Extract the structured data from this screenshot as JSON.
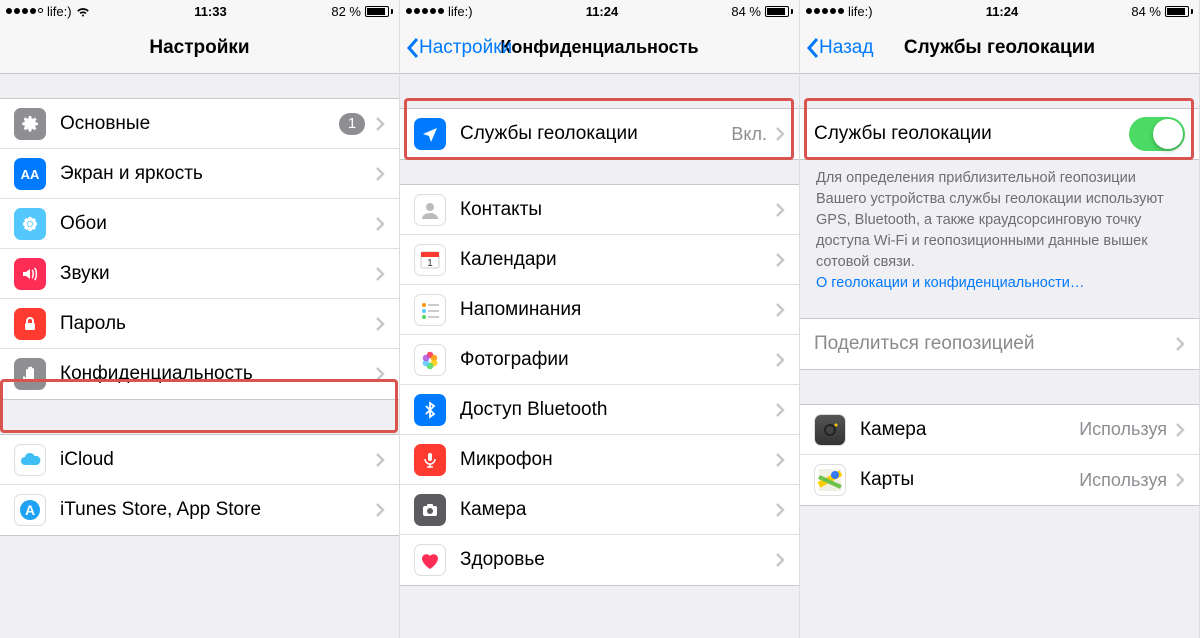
{
  "screen1": {
    "status": {
      "carrier": "life:)",
      "time": "11:33",
      "battery_pct": "82 %"
    },
    "title": "Настройки",
    "group1": [
      {
        "key": "general",
        "label": "Основные",
        "badge": "1",
        "icon": "gear",
        "color": "ic-gray"
      },
      {
        "key": "display",
        "label": "Экран и яркость",
        "icon": "text-size",
        "color": "ic-blue"
      },
      {
        "key": "wallpaper",
        "label": "Обои",
        "icon": "flower",
        "color": "ic-cyan"
      },
      {
        "key": "sounds",
        "label": "Звуки",
        "icon": "speaker",
        "color": "ic-red"
      },
      {
        "key": "passcode",
        "label": "Пароль",
        "icon": "lock",
        "color": "ic-red"
      },
      {
        "key": "privacy",
        "label": "Конфиденциальность",
        "icon": "hand",
        "color": "ic-gray"
      }
    ],
    "group2": [
      {
        "key": "icloud",
        "label": "iCloud",
        "icon": "cloud",
        "color": "ic-white"
      },
      {
        "key": "itunes",
        "label": "iTunes Store, App Store",
        "icon": "appstore",
        "color": "ic-white"
      }
    ]
  },
  "screen2": {
    "status": {
      "carrier": "life:)",
      "time": "11:24",
      "battery_pct": "84 %"
    },
    "back": "Настройки",
    "title": "Конфиденциальность",
    "group1": [
      {
        "key": "location",
        "label": "Службы геолокации",
        "detail": "Вкл.",
        "icon": "location",
        "color": "ic-blue"
      }
    ],
    "group2": [
      {
        "key": "contacts",
        "label": "Контакты",
        "icon": "contact",
        "color": "ic-white"
      },
      {
        "key": "calendar",
        "label": "Календари",
        "icon": "calendar",
        "color": "ic-white"
      },
      {
        "key": "reminders",
        "label": "Напоминания",
        "icon": "reminders",
        "color": "ic-white"
      },
      {
        "key": "photos",
        "label": "Фотографии",
        "icon": "photos",
        "color": "ic-white"
      },
      {
        "key": "bluetooth",
        "label": "Доступ Bluetooth",
        "icon": "bluetooth",
        "color": "ic-blue"
      },
      {
        "key": "microphone",
        "label": "Микрофон",
        "icon": "mic",
        "color": "ic-red"
      },
      {
        "key": "camera",
        "label": "Камера",
        "icon": "camera",
        "color": "ic-darkgray"
      },
      {
        "key": "health",
        "label": "Здоровье",
        "icon": "heart",
        "color": "ic-white"
      }
    ]
  },
  "screen3": {
    "status": {
      "carrier": "life:)",
      "time": "11:24",
      "battery_pct": "84 %"
    },
    "back": "Назад",
    "title": "Службы геолокации",
    "toggle_row": {
      "label": "Службы геолокации",
      "on": true
    },
    "footer_text": "Для определения приблизительной геопозиции Вашего устройства службы геолокации используют GPS, Bluetooth, а также краудсорсинговую точку доступа Wi-Fi и геопозиционными данные вышек сотовой связи.",
    "footer_link": "О геолокации и конфиденциальности…",
    "share_row": {
      "label": "Поделиться геопозицией"
    },
    "apps": [
      {
        "key": "camera",
        "label": "Камера",
        "detail": "Используя",
        "icon": "camera-app",
        "color": "ic-white"
      },
      {
        "key": "maps",
        "label": "Карты",
        "detail": "Используя",
        "icon": "maps",
        "color": "ic-white"
      }
    ]
  }
}
